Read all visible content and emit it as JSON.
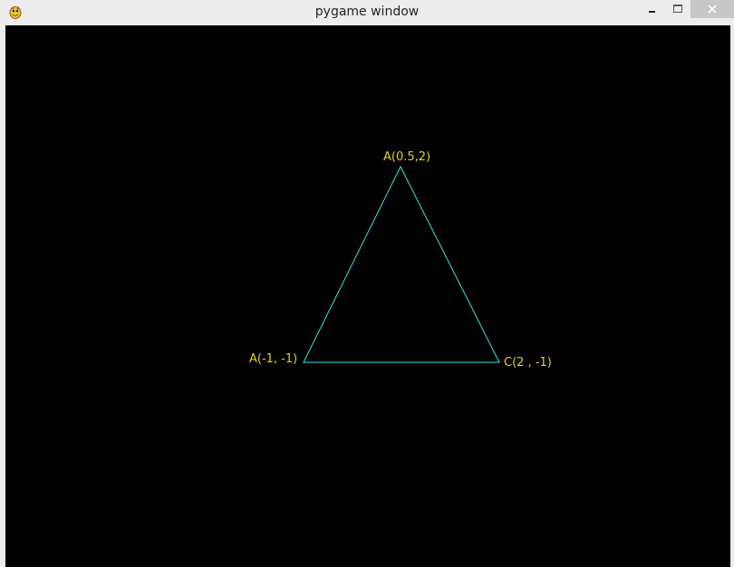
{
  "window": {
    "title": "pygame window",
    "icon": "pygame-snake-icon",
    "controls": {
      "minimize_icon": "minimize-icon",
      "maximize_icon": "maximize-icon",
      "close_icon": "close-icon"
    }
  },
  "canvas": {
    "background": "#000000",
    "triangle": {
      "stroke_color": "#33e6e6",
      "vertices": [
        {
          "label": "A(0.5,2)"
        },
        {
          "label": "A(-1, -1)"
        },
        {
          "label": "C(2 , -1)"
        }
      ]
    },
    "label_color": "#e8d21e"
  }
}
